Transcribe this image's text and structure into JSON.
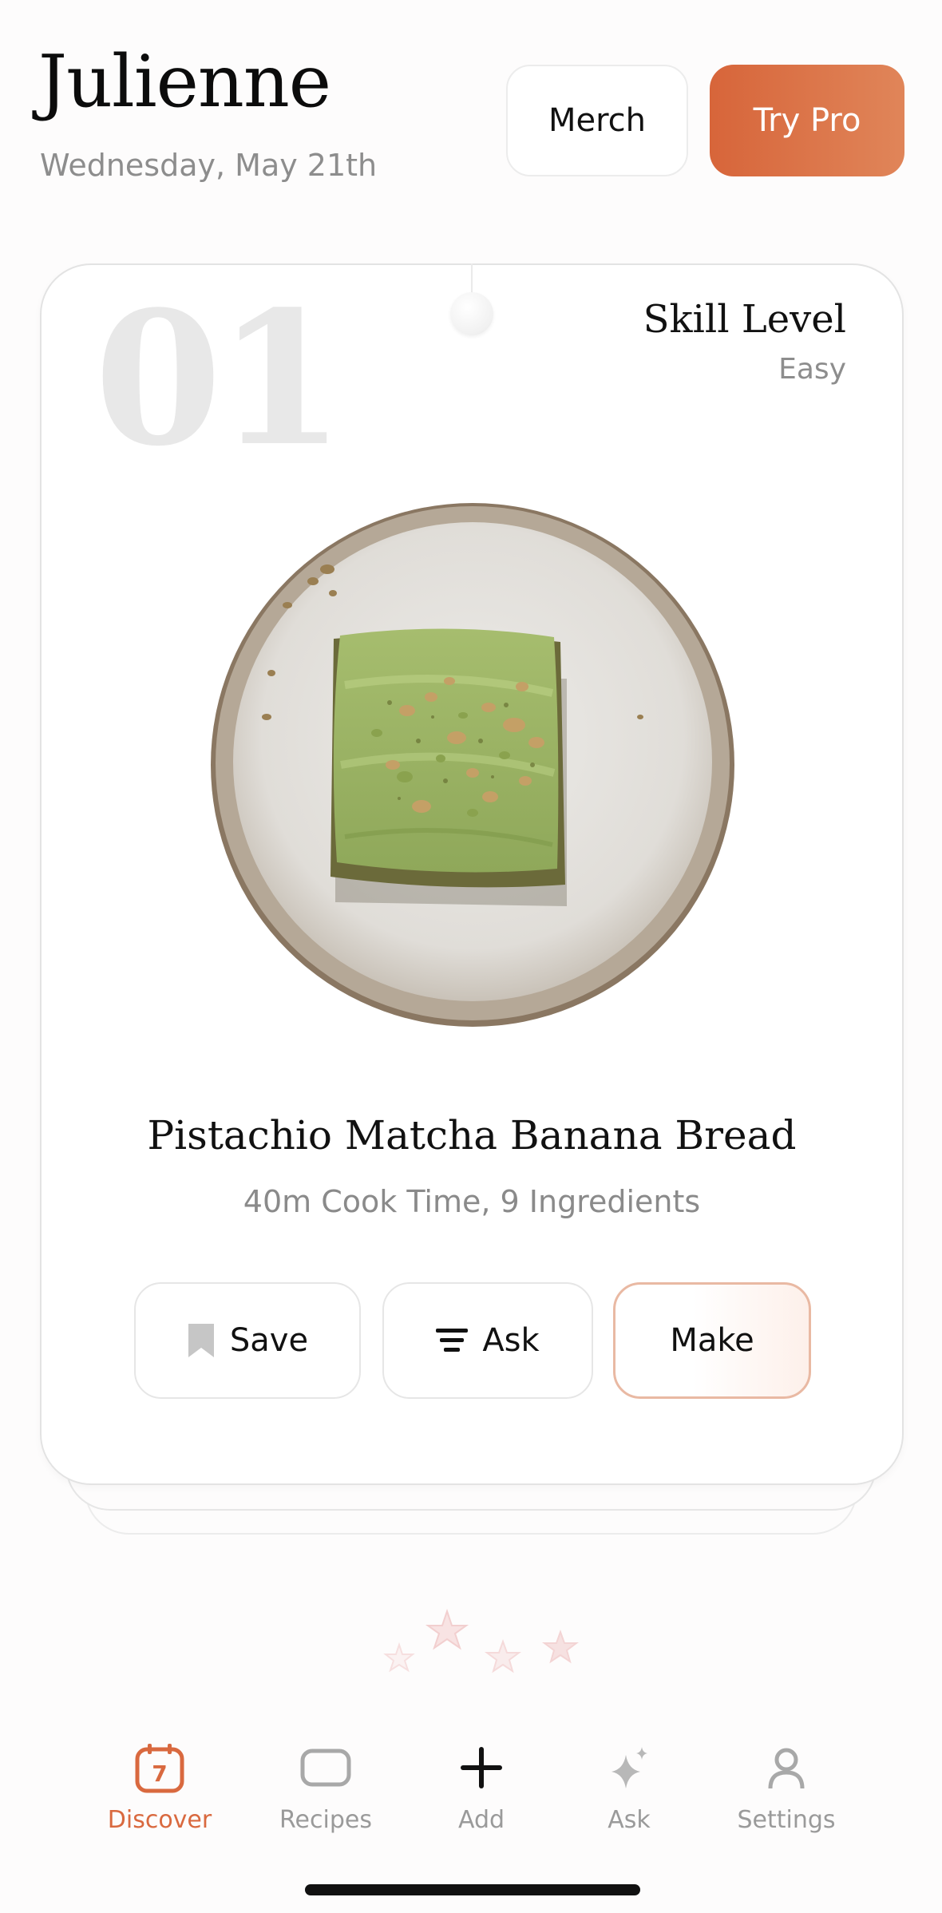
{
  "header": {
    "app_title": "Julienne",
    "date": "Wednesday, May 21th",
    "merch_label": "Merch",
    "pro_label": "Try Pro"
  },
  "card": {
    "number": "01",
    "skill_label": "Skill Level",
    "skill_value": "Easy",
    "image_subject": "pistachio-matcha-banana-bread-on-plate",
    "title": "Pistachio Matcha Banana Bread",
    "meta": "40m Cook Time, 9 Ingredients",
    "actions": {
      "save": "Save",
      "ask": "Ask",
      "make": "Make"
    }
  },
  "tabbar": {
    "items": [
      {
        "label": "Discover",
        "icon": "calendar-icon",
        "active": true,
        "badge": "7"
      },
      {
        "label": "Recipes",
        "icon": "card-icon",
        "active": false
      },
      {
        "label": "Add",
        "icon": "plus-icon",
        "active": false
      },
      {
        "label": "Ask",
        "icon": "sparkle-icon",
        "active": false
      },
      {
        "label": "Settings",
        "icon": "person-icon",
        "active": false
      }
    ]
  },
  "colors": {
    "accent": "#d9693f",
    "pro_gradient_start": "#d7653a",
    "pro_gradient_end": "#e08559",
    "muted_text": "#8d8d8d"
  }
}
